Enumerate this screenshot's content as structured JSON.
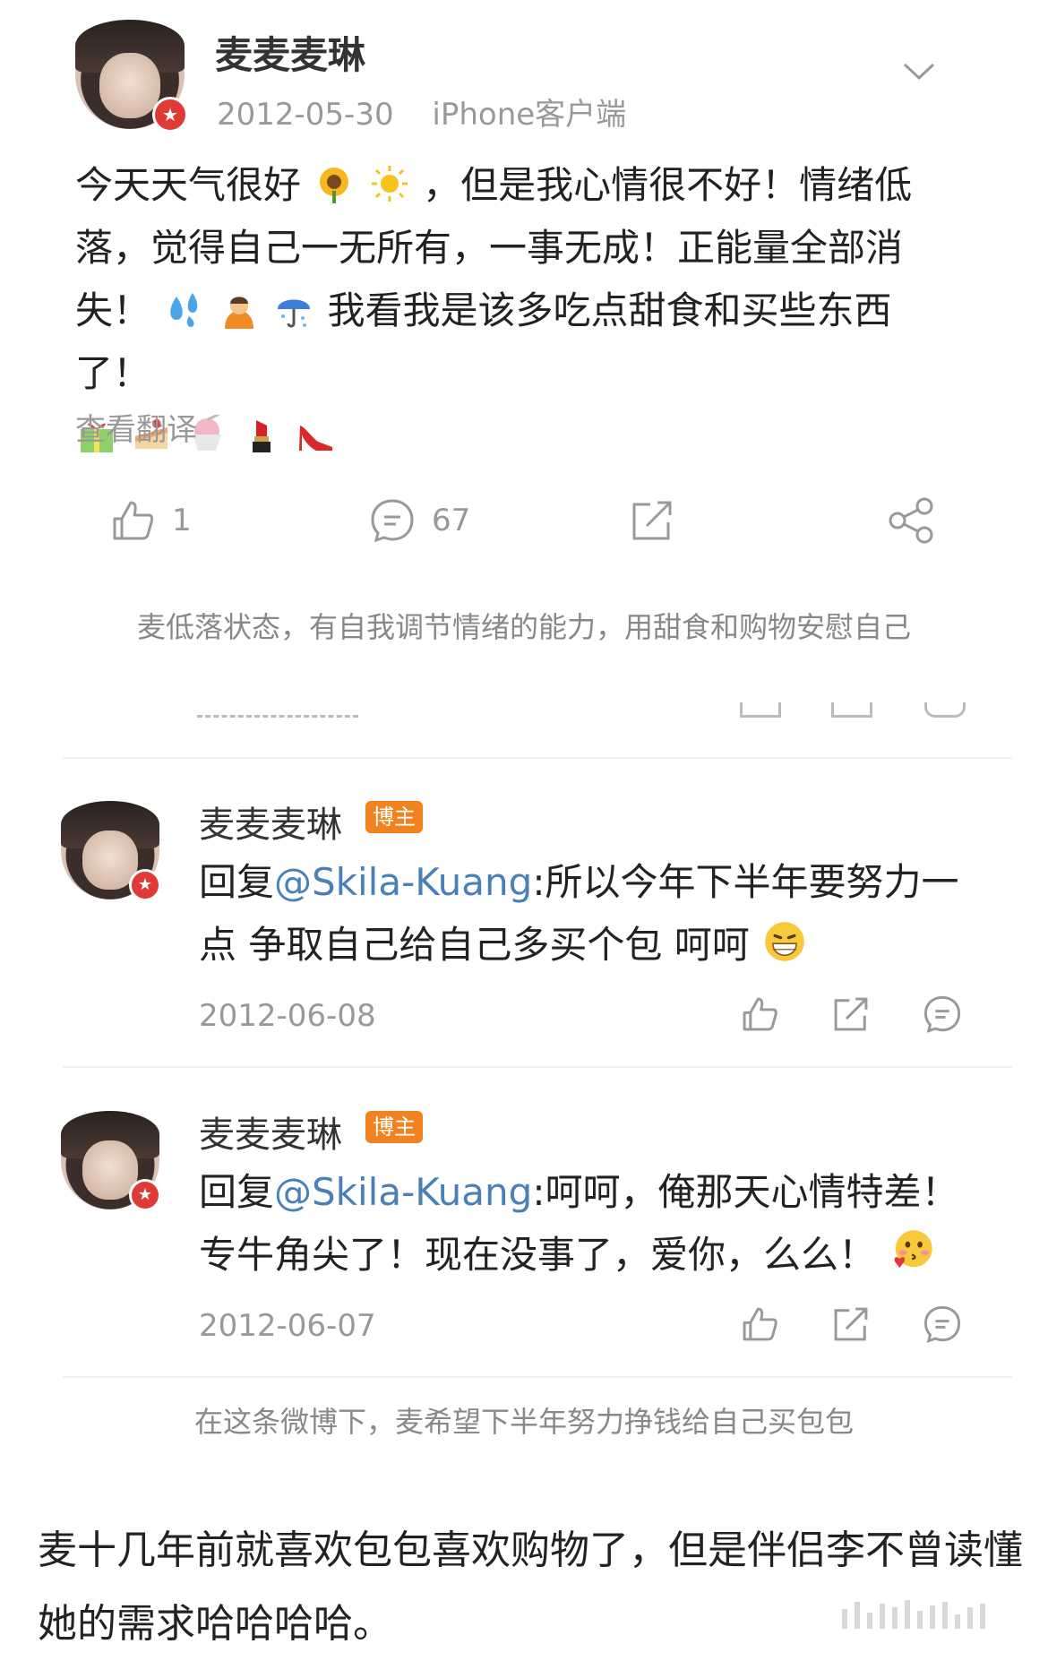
{
  "post": {
    "author": "麦麦麦琳",
    "date": "2012-05-30",
    "source": "iPhone客户端",
    "text_part1": "今天天气很好",
    "text_part2": "，但是我心情很不好！情绪低落，觉得自己一无所有，一事无成！正能量全部消失！",
    "text_part3": "我看我是该多吃点甜食和买些东西了！",
    "translate_label": "查看翻译",
    "like_count": "1",
    "comment_count": "67",
    "emojis": [
      "sunflower-icon",
      "sun-icon",
      "sweat-drops-icon",
      "bowing-person-icon",
      "umbrella-icon",
      "gift-icon",
      "cake-icon",
      "shaved-ice-icon",
      "lipstick-icon",
      "high-heel-icon"
    ]
  },
  "caption1": "麦低落状态，有自我调节情绪的能力，用甜食和购物安慰自己",
  "replies": [
    {
      "author": "麦麦麦琳",
      "tag": "博主",
      "reply_prefix": "回复",
      "mention": "@Skila-Kuang",
      "text": ":所以今年下半年要努力一点 争取自己给自己多买个包 呵呵",
      "date": "2012-06-08"
    },
    {
      "author": "麦麦麦琳",
      "tag": "博主",
      "reply_prefix": "回复",
      "mention": "@Skila-Kuang",
      "text": ":呵呵，俺那天心情特差！专牛角尖了！现在没事了，爱你，么么！",
      "date": "2012-06-07"
    }
  ],
  "caption2": "在这条微博下，麦希望下半年努力挣钱给自己买包包",
  "footer": "麦十几年前就喜欢包包喜欢购物了，但是伴侣李不曾读懂她的需求哈哈哈哈。",
  "colors": {
    "accent_link": "#4a7fb8",
    "badge_red": "#e03a36",
    "tag_orange": "#f08320",
    "meta_gray": "#999999"
  }
}
